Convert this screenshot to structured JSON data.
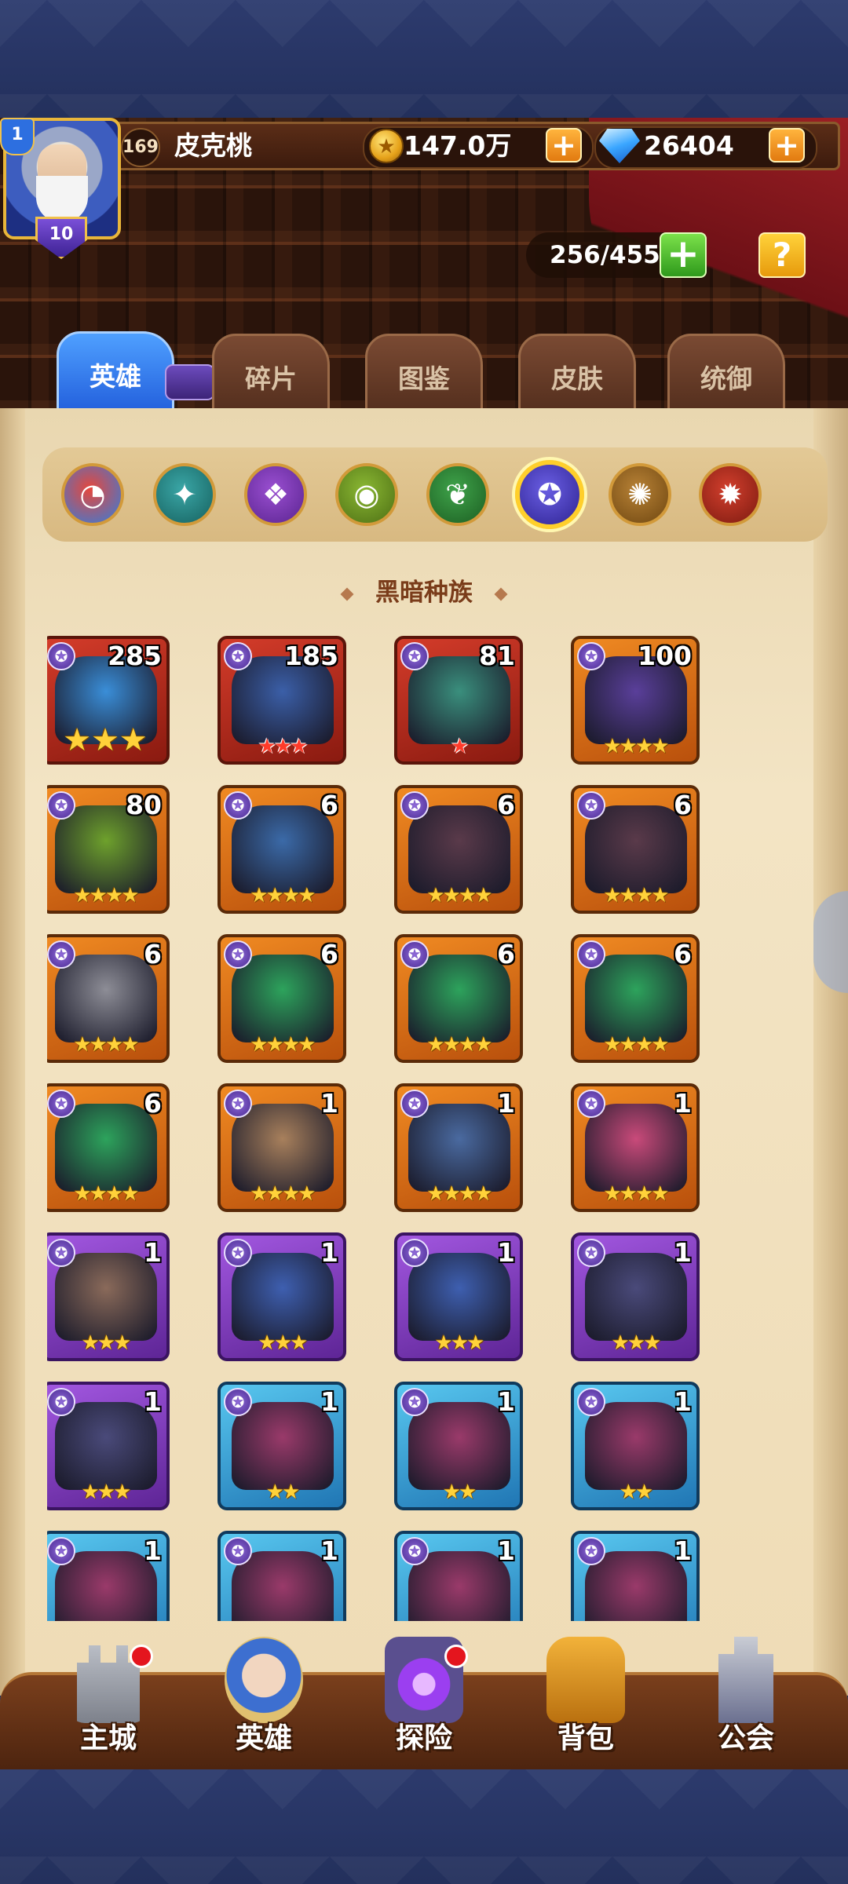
{
  "player": {
    "rank": "1",
    "shield_level": "10",
    "level": "169",
    "name": "皮克桃"
  },
  "resources": {
    "gold": "147.0万",
    "gems": "26404",
    "plus": "+"
  },
  "hero_capacity": "256/455",
  "help_label": "?",
  "tabs": [
    {
      "label": "英雄",
      "active": true
    },
    {
      "label": "碎片",
      "active": false
    },
    {
      "label": "图鉴",
      "active": false
    },
    {
      "label": "皮肤",
      "active": false
    },
    {
      "label": "统御",
      "active": false
    }
  ],
  "race_filters": [
    {
      "name": "all",
      "colors": [
        "#e7473b",
        "#2f7fe0"
      ]
    },
    {
      "name": "nature",
      "colors": [
        "#3aa6a6",
        "#16615f"
      ]
    },
    {
      "name": "mage",
      "colors": [
        "#9a4fd1",
        "#5a2490"
      ]
    },
    {
      "name": "elf",
      "colors": [
        "#8ab733",
        "#4d6f14"
      ]
    },
    {
      "name": "forest",
      "colors": [
        "#3fa34a",
        "#1c5e22"
      ]
    },
    {
      "name": "dark",
      "colors": [
        "#6a5ee3",
        "#2e2392"
      ],
      "selected": true
    },
    {
      "name": "light",
      "colors": [
        "#b88236",
        "#6e4610"
      ]
    },
    {
      "name": "fire",
      "colors": [
        "#d23f2d",
        "#7c1a10"
      ]
    }
  ],
  "section_title": "黑暗种族",
  "heroes": [
    {
      "level": "285",
      "stars": "★★★",
      "star_style": "big",
      "quality": "red",
      "portrait": "#3a8ed8"
    },
    {
      "level": "185",
      "stars": "★★★",
      "star_style": "red",
      "quality": "red",
      "portrait": "#3b5fa8"
    },
    {
      "level": "81",
      "stars": "★",
      "star_style": "red",
      "quality": "red",
      "portrait": "#3a8f7d"
    },
    {
      "level": "100",
      "stars": "★★★★",
      "star_style": "gold",
      "quality": "orange",
      "portrait": "#5a3f9a"
    },
    {
      "level": "80",
      "stars": "★★★★",
      "star_style": "gold",
      "quality": "orange",
      "portrait": "#6ea12c"
    },
    {
      "level": "6",
      "stars": "★★★★",
      "star_style": "gold",
      "quality": "orange",
      "portrait": "#3b6aa8"
    },
    {
      "level": "6",
      "stars": "★★★★",
      "star_style": "gold",
      "quality": "orange",
      "portrait": "#5a3a4a"
    },
    {
      "level": "6",
      "stars": "★★★★",
      "star_style": "gold",
      "quality": "orange",
      "portrait": "#5a3a4a"
    },
    {
      "level": "6",
      "stars": "★★★★",
      "star_style": "gold",
      "quality": "orange",
      "portrait": "#8d8d96"
    },
    {
      "level": "6",
      "stars": "★★★★",
      "star_style": "gold",
      "quality": "orange",
      "portrait": "#2da35c"
    },
    {
      "level": "6",
      "stars": "★★★★",
      "star_style": "gold",
      "quality": "orange",
      "portrait": "#2da35c"
    },
    {
      "level": "6",
      "stars": "★★★★",
      "star_style": "gold",
      "quality": "orange",
      "portrait": "#2da35c"
    },
    {
      "level": "6",
      "stars": "★★★★",
      "star_style": "gold",
      "quality": "orange",
      "portrait": "#2da35c"
    },
    {
      "level": "1",
      "stars": "★★★★",
      "star_style": "gold",
      "quality": "orange",
      "portrait": "#a8805c"
    },
    {
      "level": "1",
      "stars": "★★★★",
      "star_style": "gold",
      "quality": "orange",
      "portrait": "#4a6aa0"
    },
    {
      "level": "1",
      "stars": "★★★★",
      "star_style": "gold",
      "quality": "orange",
      "portrait": "#c94a7a"
    },
    {
      "level": "1",
      "stars": "★★★",
      "star_style": "gold",
      "quality": "purple",
      "portrait": "#8a6a5a"
    },
    {
      "level": "1",
      "stars": "★★★",
      "star_style": "gold",
      "quality": "purple",
      "portrait": "#3e5fb0"
    },
    {
      "level": "1",
      "stars": "★★★",
      "star_style": "gold",
      "quality": "purple",
      "portrait": "#3e5fb0"
    },
    {
      "level": "1",
      "stars": "★★★",
      "star_style": "gold",
      "quality": "purple",
      "portrait": "#4a4a7a"
    },
    {
      "level": "1",
      "stars": "★★★",
      "star_style": "gold",
      "quality": "purple",
      "portrait": "#4a4a7a"
    },
    {
      "level": "1",
      "stars": "★★",
      "star_style": "gold",
      "quality": "blue",
      "portrait": "#9a3a6a"
    },
    {
      "level": "1",
      "stars": "★★",
      "star_style": "gold",
      "quality": "blue",
      "portrait": "#9a3a6a"
    },
    {
      "level": "1",
      "stars": "★★",
      "star_style": "gold",
      "quality": "blue",
      "portrait": "#9a3a6a"
    },
    {
      "level": "1",
      "stars": "",
      "star_style": "gold",
      "quality": "blue",
      "portrait": "#9a3a6a"
    },
    {
      "level": "1",
      "stars": "",
      "star_style": "gold",
      "quality": "blue",
      "portrait": "#9a3a6a"
    },
    {
      "level": "1",
      "stars": "",
      "star_style": "gold",
      "quality": "blue",
      "portrait": "#9a3a6a"
    },
    {
      "level": "1",
      "stars": "",
      "star_style": "gold",
      "quality": "blue",
      "portrait": "#9a3a6a"
    }
  ],
  "nav": [
    {
      "label": "主城",
      "icon": "castle-icon",
      "badge": true
    },
    {
      "label": "英雄",
      "icon": "hero-icon",
      "badge": false
    },
    {
      "label": "探险",
      "icon": "portal-icon",
      "badge": true
    },
    {
      "label": "背包",
      "icon": "backpack-icon",
      "badge": false
    },
    {
      "label": "公会",
      "icon": "guild-icon",
      "badge": false
    }
  ]
}
